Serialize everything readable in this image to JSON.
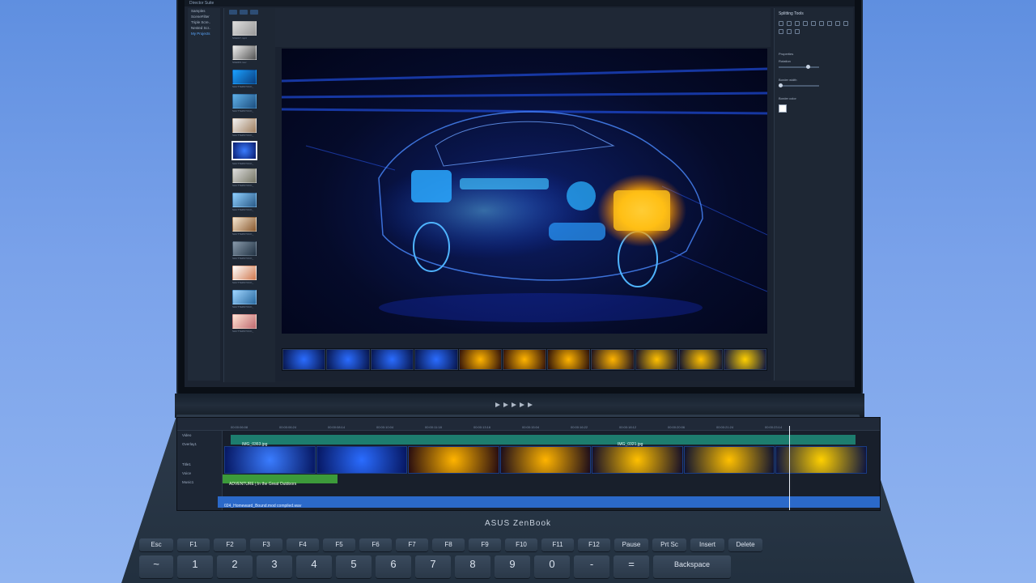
{
  "window": {
    "title": "Director Suite"
  },
  "library": {
    "tree": [
      "Samples",
      "SceneFilter",
      "Triple Scre..",
      "Nested Scr..",
      "My Projects"
    ],
    "active_index": 4,
    "thumb_captions": [
      "SKE017.mp4",
      "SKE003.mov",
      "SHUTTERSTOCK_",
      "SHUTTERSTOCK_",
      "SHUTTERSTOCK_",
      "SHUTTERSTOCK_",
      "SHUTTERSTOCK_",
      "SHUTTERSTOCK_",
      "SHUTTERSTOCK_",
      "SHUTTERSTOCK_",
      "SHUTTERSTOCK_",
      "SHUTTERSTOCK_",
      "SHUTTERSTOCK_"
    ]
  },
  "tools_panel": {
    "title": "Splitting Tools",
    "properties": "Properties",
    "rotation": "Rotation",
    "border_width": "Border width",
    "border_color": "Border color"
  },
  "timeline": {
    "ruler": [
      "00:00:06:08",
      "00:00:06:24",
      "00:00:08:14",
      "00:00:10:04",
      "00:00:11:18",
      "00:00:13:16",
      "00:00:15:04",
      "00:00:16:22",
      "00:00:18:12",
      "00:00:20:06",
      "00:00:21:24",
      "00:00:23:14"
    ],
    "tracks": {
      "video": "Video",
      "overlay": "Overlay1",
      "title": "Title1",
      "voice": "Voice",
      "music": "Music1"
    },
    "clip_left": "IMG_0363.jpg",
    "clip_right": "IMG_0321.jpg",
    "title_clip": "ADVENTURE | In the Great Outdoors",
    "music_clip": "024_Homeward_Bound.mod compiled.wav"
  },
  "brand": "ASUS ZenBook",
  "keyboard": {
    "fn_row": [
      "Esc",
      "F1",
      "F2",
      "F3",
      "F4",
      "F5",
      "F6",
      "F7",
      "F8",
      "F9",
      "F10",
      "F11",
      "F12",
      "Pause",
      "Prt Sc",
      "Insert",
      "Delete"
    ],
    "num_row": [
      "~",
      "1",
      "2",
      "3",
      "4",
      "5",
      "6",
      "7",
      "8",
      "9",
      "0",
      "-",
      "=",
      "Backspace"
    ]
  }
}
